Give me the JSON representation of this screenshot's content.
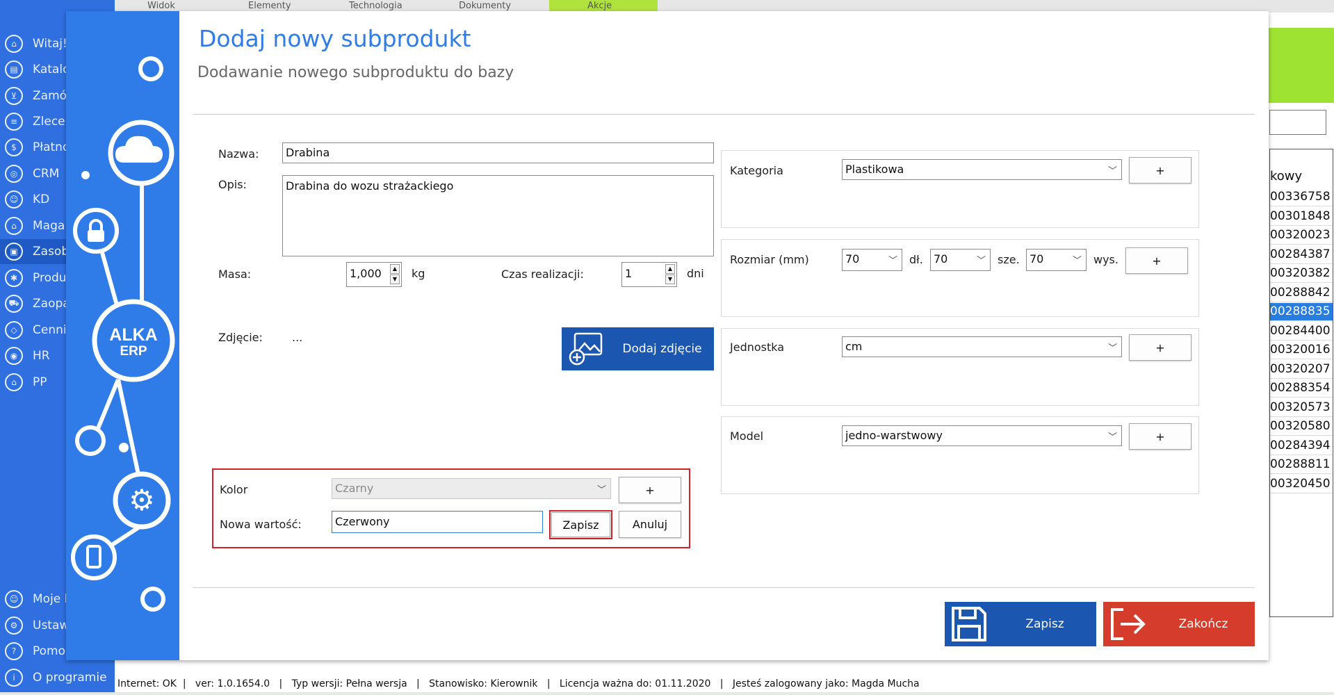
{
  "background": {
    "top_tabs": [
      "Widok",
      "Elementy",
      "Technologia",
      "Dokumenty",
      "Akcje"
    ],
    "sidebar_items": [
      {
        "label": "Witaj!",
        "icon": "home-icon"
      },
      {
        "label": "Katalo",
        "icon": "book-icon"
      },
      {
        "label": "Zamó",
        "icon": "cart-icon"
      },
      {
        "label": "Zlecen",
        "icon": "list-icon"
      },
      {
        "label": "Płatno",
        "icon": "dollar-icon"
      },
      {
        "label": "CRM",
        "icon": "crm-icon"
      },
      {
        "label": "KD",
        "icon": "person-icon"
      },
      {
        "label": "Maga",
        "icon": "warehouse-icon"
      },
      {
        "label": "Zasob",
        "icon": "resources-icon"
      },
      {
        "label": "Produ",
        "icon": "production-icon"
      },
      {
        "label": "Zaopa",
        "icon": "truck-icon"
      },
      {
        "label": "Cennik",
        "icon": "tag-icon"
      },
      {
        "label": "HR",
        "icon": "hr-icon"
      },
      {
        "label": "PP",
        "icon": "factory-icon"
      }
    ],
    "sidebar_bottom": [
      {
        "label": "Moje l",
        "icon": "user-icon"
      },
      {
        "label": "Ustawi",
        "icon": "settings-icon"
      },
      {
        "label": "Pomo",
        "icon": "help-icon"
      },
      {
        "label": "O programie",
        "icon": "info-icon"
      }
    ],
    "right_list_header": "kowy",
    "right_list_rows": [
      "00336758",
      "00301848",
      "00320023",
      "00284387",
      "00320382",
      "00288842",
      "00288835",
      "00284400",
      "00320016",
      "00320207",
      "00288354",
      "00320573",
      "00320580",
      "00284394",
      "00288811",
      "00320450"
    ],
    "right_list_selected_index": 6,
    "status_bar": "Internet: OK  |   ver: 1.0.1654.0   |   Typ wersji: Pełna wersja   |   Stanowisko: Kierownik   |   Licencja ważna do: 01.11.2020   |   Jesteś zalogowany jako: Magda Mucha"
  },
  "modal": {
    "title": "Dodaj nowy subprodukt",
    "subtitle": "Dodawanie nowego subproduktu do bazy",
    "logo_line1": "ALKA",
    "logo_line2": "ERP",
    "name_label": "Nazwa:",
    "name_value": "Drabina",
    "desc_label": "Opis:",
    "desc_value": "Drabina do wozu strażackiego",
    "mass_label": "Masa:",
    "mass_value": "1,000",
    "mass_unit": "kg",
    "time_label": "Czas realizacji:",
    "time_value": "1",
    "time_unit": "dni",
    "photo_label": "Zdjęcie:",
    "photo_value": "...",
    "add_photo_label": "Dodaj zdjęcie",
    "category_label": "Kategoria",
    "category_value": "Plastikowa",
    "size_label": "Rozmiar (mm)",
    "size_length": "70",
    "size_length_label": "dł.",
    "size_width": "70",
    "size_width_label": "sze.",
    "size_height": "70",
    "size_height_label": "wys.",
    "unit_label": "Jednostka",
    "unit_value": "cm",
    "model_label": "Model",
    "model_value": "jedno-warstwowy",
    "color_label": "Kolor",
    "color_value": "Czarny",
    "new_value_label": "Nowa wartość:",
    "new_value": "Czerwony",
    "inline_save": "Zapisz",
    "inline_cancel": "Anuluj",
    "plus": "+",
    "save_label": "Zapisz",
    "close_label": "Zakończ"
  },
  "colors": {
    "accent_blue": "#2f7ce9",
    "dark_blue_button": "#1b57b0",
    "red_button": "#d63c2c",
    "highlight_red": "#d3202a",
    "green_tab": "#b0e23e"
  }
}
